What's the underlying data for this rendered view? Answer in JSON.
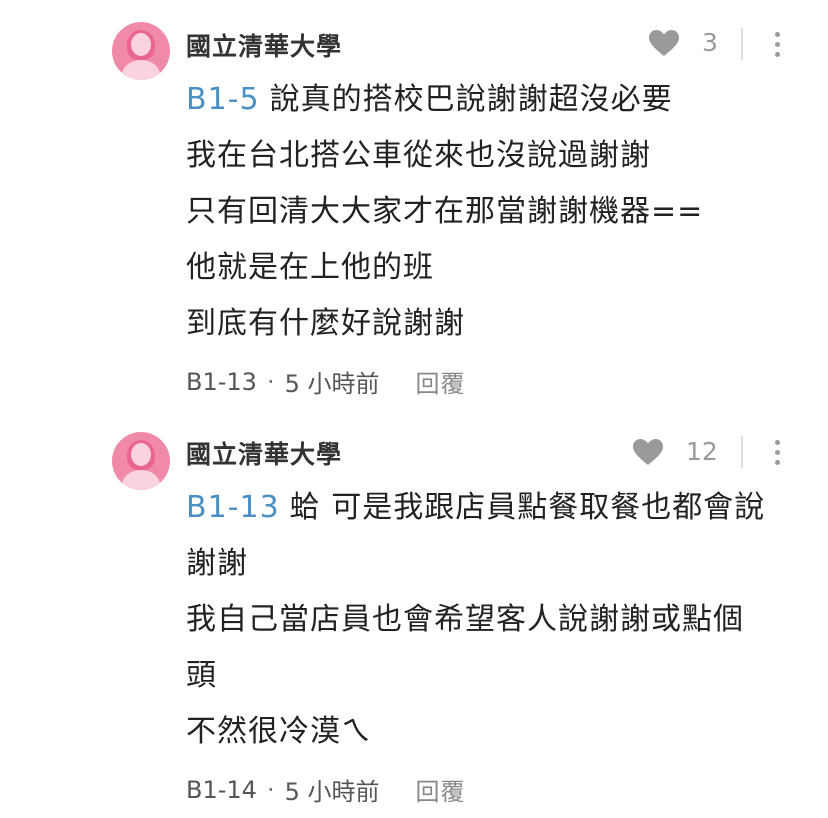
{
  "comments": [
    {
      "author": "國立清華大學",
      "likes": "3",
      "mention": "B1-5",
      "lines": [
        "說真的搭校巴說謝謝超沒必要",
        "我在台北搭公車從來也沒說過謝謝",
        "只有回清大大家才在那當謝謝機器==",
        "他就是在上他的班",
        "到底有什麼好說謝謝"
      ],
      "floor": "B1-13",
      "separator": "·",
      "time": "5 小時前",
      "reply_label": "回覆"
    },
    {
      "author": "國立清華大學",
      "likes": "12",
      "mention": "B1-13",
      "lines": [
        "蛤 可是我跟店員點餐取餐也都會說",
        "謝謝",
        "我自己當店員也會希望客人說謝謝或點個",
        "頭",
        "不然很冷漠ㄟ"
      ],
      "floor": "B1-14",
      "separator": "·",
      "time": "5 小時前",
      "reply_label": "回覆"
    }
  ],
  "icons": {
    "avatar": "avatar-icon",
    "like": "heart-icon",
    "more": "more-vertical-icon"
  },
  "colors": {
    "mention": "#4a90c2",
    "avatar": "#f08aa8",
    "icon_gray": "#9a9a9a"
  }
}
